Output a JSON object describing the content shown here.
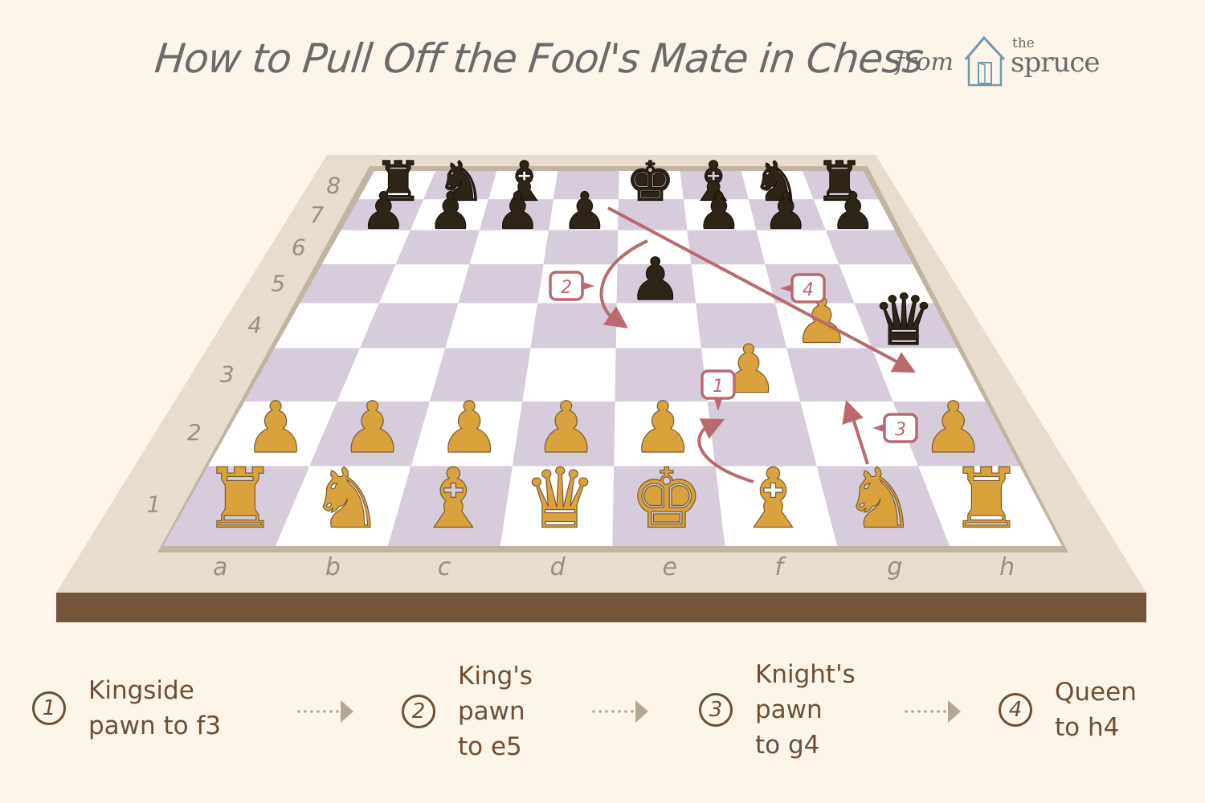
{
  "header": {
    "title": "How to Pull Off the Fool's Mate in Chess",
    "from_label": "from",
    "brand_small": "the",
    "brand_large": "spruce"
  },
  "colors": {
    "background": "#fdf4ea",
    "frame": "#e7dccd",
    "frame_inner_edge": "#c2b4a2",
    "frame_base": "#735539",
    "square_light": "#ffffff",
    "square_dark": "#d6ccdc",
    "arrow": "#b86a6e",
    "text_brown": "#6e4f34",
    "label_gray": "#9c8f80"
  },
  "board": {
    "files": [
      "a",
      "b",
      "c",
      "d",
      "e",
      "f",
      "g",
      "h"
    ],
    "ranks": [
      "1",
      "2",
      "3",
      "4",
      "5",
      "6",
      "7",
      "8"
    ],
    "pieces": [
      {
        "square": "a8",
        "color": "black",
        "type": "rook"
      },
      {
        "square": "b8",
        "color": "black",
        "type": "knight"
      },
      {
        "square": "c8",
        "color": "black",
        "type": "bishop"
      },
      {
        "square": "e8",
        "color": "black",
        "type": "king"
      },
      {
        "square": "f8",
        "color": "black",
        "type": "bishop"
      },
      {
        "square": "g8",
        "color": "black",
        "type": "knight"
      },
      {
        "square": "h8",
        "color": "black",
        "type": "rook"
      },
      {
        "square": "a7",
        "color": "black",
        "type": "pawn"
      },
      {
        "square": "b7",
        "color": "black",
        "type": "pawn"
      },
      {
        "square": "c7",
        "color": "black",
        "type": "pawn"
      },
      {
        "square": "d7",
        "color": "black",
        "type": "pawn"
      },
      {
        "square": "f7",
        "color": "black",
        "type": "pawn"
      },
      {
        "square": "g7",
        "color": "black",
        "type": "pawn"
      },
      {
        "square": "h7",
        "color": "black",
        "type": "pawn"
      },
      {
        "square": "e5",
        "color": "black",
        "type": "pawn"
      },
      {
        "square": "h4",
        "color": "black",
        "type": "queen"
      },
      {
        "square": "g4",
        "color": "white",
        "type": "pawn"
      },
      {
        "square": "f3",
        "color": "white",
        "type": "pawn"
      },
      {
        "square": "a2",
        "color": "white",
        "type": "pawn"
      },
      {
        "square": "b2",
        "color": "white",
        "type": "pawn"
      },
      {
        "square": "c2",
        "color": "white",
        "type": "pawn"
      },
      {
        "square": "d2",
        "color": "white",
        "type": "pawn"
      },
      {
        "square": "e2",
        "color": "white",
        "type": "pawn"
      },
      {
        "square": "h2",
        "color": "white",
        "type": "pawn"
      },
      {
        "square": "a1",
        "color": "white",
        "type": "rook"
      },
      {
        "square": "b1",
        "color": "white",
        "type": "knight"
      },
      {
        "square": "c1",
        "color": "white",
        "type": "bishop"
      },
      {
        "square": "d1",
        "color": "white",
        "type": "queen"
      },
      {
        "square": "e1",
        "color": "white",
        "type": "king"
      },
      {
        "square": "f1",
        "color": "white",
        "type": "bishop"
      },
      {
        "square": "g1",
        "color": "white",
        "type": "knight"
      },
      {
        "square": "h1",
        "color": "white",
        "type": "rook"
      }
    ],
    "move_arrows": [
      {
        "label": "1",
        "from": "f2",
        "to": "f3"
      },
      {
        "label": "2",
        "from": "e7",
        "to": "e5"
      },
      {
        "label": "3",
        "from": "g2",
        "to": "g4"
      },
      {
        "label": "4",
        "from": "d8",
        "to": "h4"
      }
    ]
  },
  "steps": [
    {
      "number": "1",
      "text": "Kingside\npawn to f3"
    },
    {
      "number": "2",
      "text": "King's\npawn\nto e5"
    },
    {
      "number": "3",
      "text": "Knight's\npawn\nto g4"
    },
    {
      "number": "4",
      "text": "Queen\nto h4"
    }
  ]
}
